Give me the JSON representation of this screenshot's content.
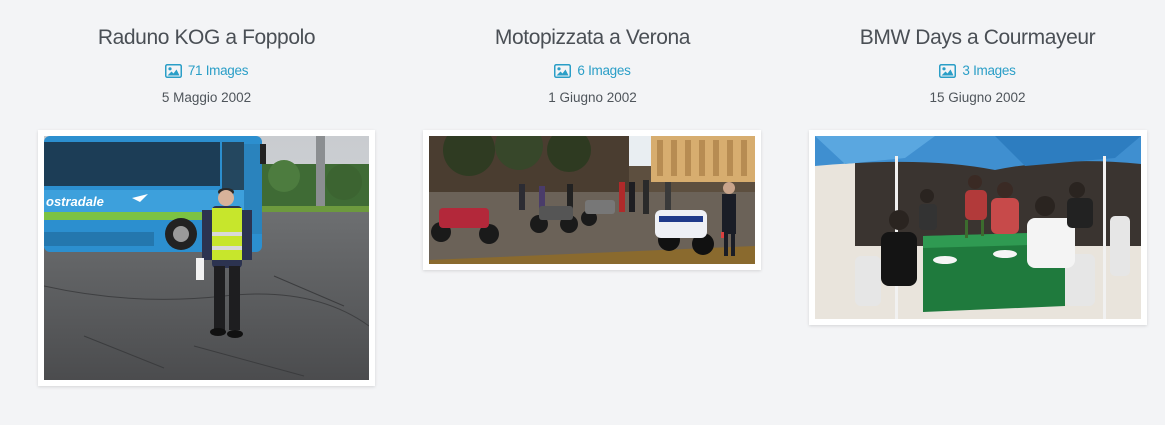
{
  "albums": [
    {
      "title": "Raduno KOG a Foppolo",
      "count_label": "71 Images",
      "date": "5 Maggio 2002",
      "icon": "image-icon",
      "photo_subject": "bus-and-person-in-safety-vest",
      "bus_text": "ostradale"
    },
    {
      "title": "Motopizzata a Verona",
      "count_label": "6 Images",
      "date": "1 Giugno 2002",
      "icon": "image-icon",
      "photo_subject": "motorcycles-in-piazza"
    },
    {
      "title": "BMW Days a Courmayeur",
      "count_label": "3 Images",
      "date": "15 Giugno 2002",
      "icon": "image-icon",
      "photo_subject": "outdoor-dining-under-umbrellas"
    }
  ],
  "colors": {
    "background": "#f3f4f6",
    "title": "#4a4f55",
    "link": "#2a9ec7",
    "date": "#4f555b",
    "frame": "#ffffff"
  }
}
